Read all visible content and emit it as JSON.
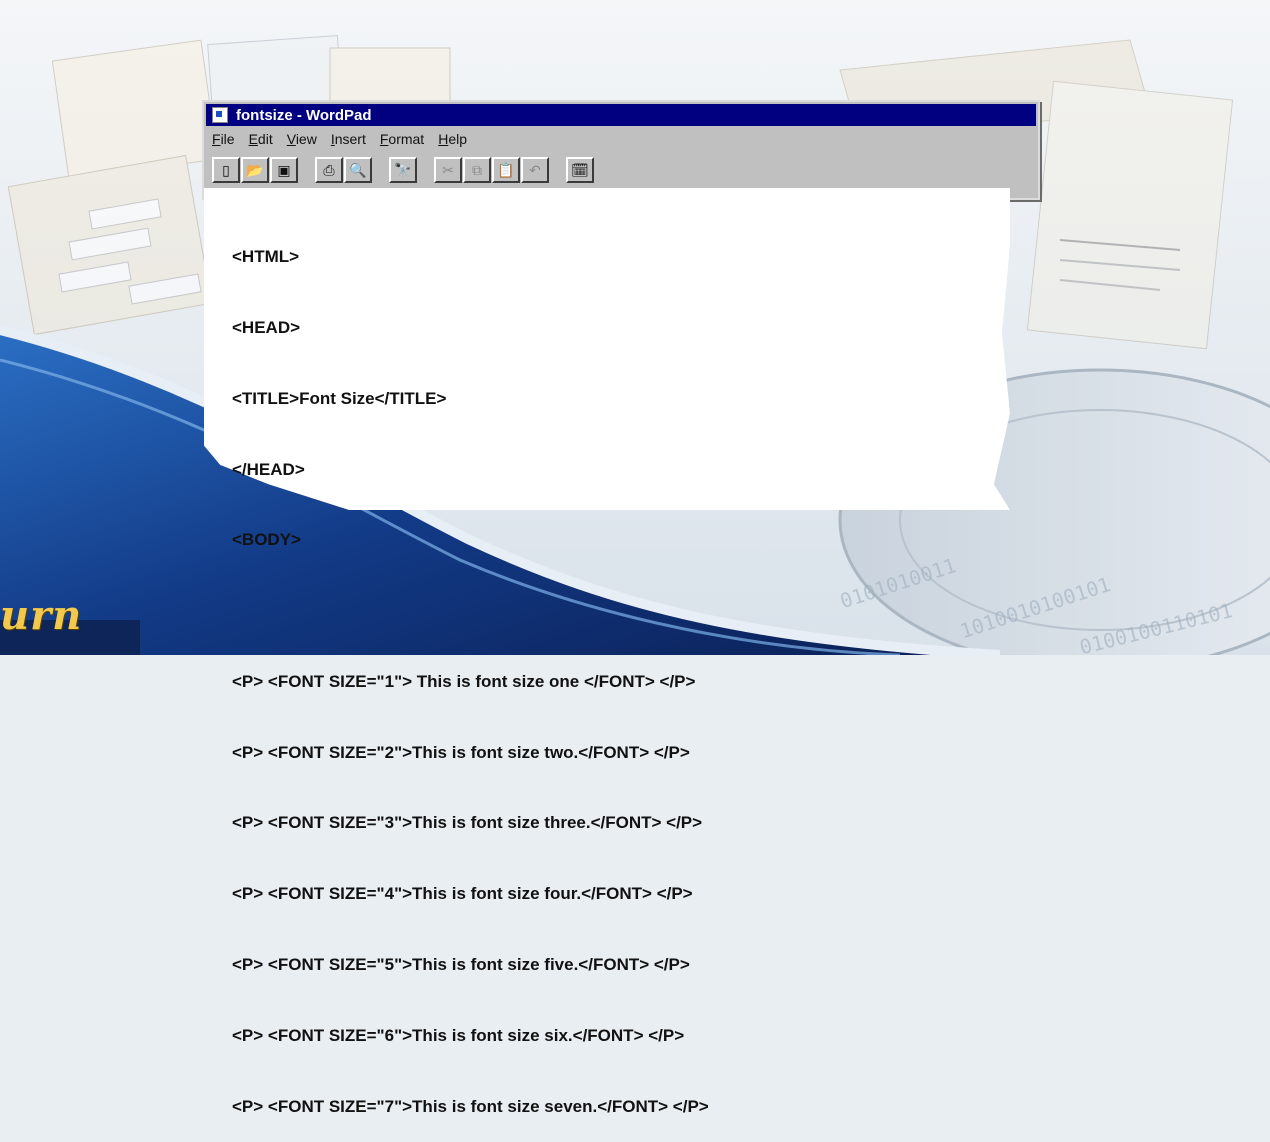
{
  "brand": {
    "text": "urn"
  },
  "window": {
    "title": "fontsize - WordPad",
    "menu": [
      "File",
      "Edit",
      "View",
      "Insert",
      "Format",
      "Help"
    ],
    "toolbar": [
      {
        "icon": "new-doc-icon",
        "glyph": "▯"
      },
      {
        "icon": "open-folder-icon",
        "glyph": "📂"
      },
      {
        "icon": "save-icon",
        "glyph": "▣"
      },
      {
        "icon": "print-icon",
        "glyph": "⎙"
      },
      {
        "icon": "print-preview-icon",
        "glyph": "🔍"
      },
      {
        "icon": "find-icon",
        "glyph": "🔭"
      },
      {
        "icon": "cut-icon",
        "glyph": "✂"
      },
      {
        "icon": "copy-icon",
        "glyph": "⧉"
      },
      {
        "icon": "paste-icon",
        "glyph": "📋"
      },
      {
        "icon": "undo-icon",
        "glyph": "↶"
      },
      {
        "icon": "datetime-icon",
        "glyph": "🗓"
      }
    ]
  },
  "document": {
    "lines": [
      "<HTML>",
      "<HEAD>",
      "<TITLE>Font Size</TITLE>",
      "</HEAD>",
      "<BODY>",
      "",
      "<P> <FONT SIZE=\"1\"> This is font size one </FONT> </P>",
      "<P> <FONT SIZE=\"2\">This is font size two.</FONT> </P>",
      "<P> <FONT SIZE=\"3\">This is font size three.</FONT> </P>",
      "<P> <FONT SIZE=\"4\">This is font size four.</FONT> </P>",
      "<P> <FONT SIZE=\"5\">This is font size five.</FONT> </P>",
      "<P> <FONT SIZE=\"6\">This is font size six.</FONT> </P>",
      "<P> <FONT SIZE=\"7\">This is font size seven.</FONT> </P>"
    ]
  }
}
